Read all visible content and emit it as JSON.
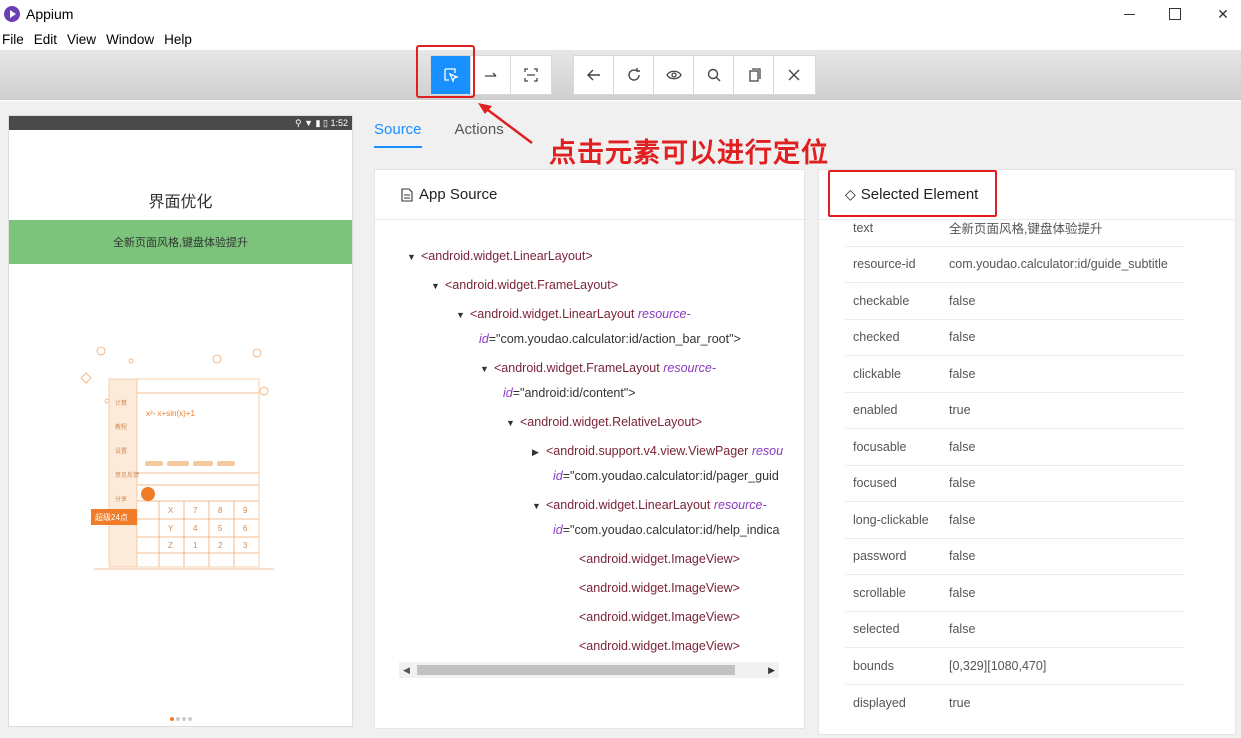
{
  "window": {
    "title": "Appium"
  },
  "menu": [
    "File",
    "Edit",
    "View",
    "Window",
    "Help"
  ],
  "toolbar": {
    "group1": [
      {
        "name": "select-elements-icon",
        "active": true
      },
      {
        "name": "swipe-icon",
        "active": false
      },
      {
        "name": "tap-coordinates-icon",
        "active": false
      }
    ],
    "group2": [
      {
        "name": "back-icon"
      },
      {
        "name": "refresh-icon"
      },
      {
        "name": "eye-icon"
      },
      {
        "name": "search-icon"
      },
      {
        "name": "copy-icon"
      },
      {
        "name": "close-icon"
      }
    ]
  },
  "device": {
    "status_time": "1:52",
    "title": "界面优化",
    "banner": "全新页面风格,键盘体验提升",
    "illus": {
      "side_items": [
        "计算",
        "教程",
        "设置",
        "意见反馈",
        "分享"
      ],
      "formula": "x²- x+sin(x)+1",
      "badge": "超级24点",
      "keys": [
        "X",
        "7",
        "8",
        "9",
        "Y",
        "4",
        "5",
        "6",
        "Z",
        "1",
        "2",
        "3"
      ]
    }
  },
  "tabs": {
    "source": "Source",
    "actions": "Actions"
  },
  "annotation": "点击元素可以进行定位",
  "source_panel": {
    "title": "App Source",
    "nodes": [
      {
        "tag": "<android.widget.LinearLayout>",
        "attr": "",
        "attr_val": ""
      },
      {
        "tag": "<android.widget.FrameLayout>",
        "attr": "",
        "attr_val": ""
      },
      {
        "tag": "<android.widget.LinearLayout",
        "attr": "resource-",
        "line2_attr": "id",
        "attr_val": "=\"com.youdao.calculator:id/action_bar_root\">"
      },
      {
        "tag": "<android.widget.FrameLayout",
        "attr": "resource-",
        "line2_attr": "id",
        "attr_val": "=\"android:id/content\">"
      },
      {
        "tag": "<android.widget.RelativeLayout>",
        "attr": "",
        "attr_val": ""
      },
      {
        "tag": "<android.support.v4.view.ViewPager",
        "attr": "resou",
        "line2_attr": "id",
        "attr_val": "=\"com.youdao.calculator:id/pager_guid"
      },
      {
        "tag": "<android.widget.LinearLayout",
        "attr": "resource-",
        "line2_attr": "id",
        "attr_val": "=\"com.youdao.calculator:id/help_indica"
      },
      {
        "tag": "<android.widget.ImageView>",
        "attr": "",
        "attr_val": ""
      },
      {
        "tag": "<android.widget.ImageView>",
        "attr": "",
        "attr_val": ""
      },
      {
        "tag": "<android.widget.ImageView>",
        "attr": "",
        "attr_val": ""
      },
      {
        "tag": "<android.widget.ImageView>",
        "attr": "",
        "attr_val": ""
      }
    ]
  },
  "selected_panel": {
    "title": "Selected Element",
    "props": [
      {
        "k": "text",
        "v": "全新页面风格,键盘体验提升"
      },
      {
        "k": "resource-id",
        "v": "com.youdao.calculator:id/guide_subtitle"
      },
      {
        "k": "checkable",
        "v": "false"
      },
      {
        "k": "checked",
        "v": "false"
      },
      {
        "k": "clickable",
        "v": "false"
      },
      {
        "k": "enabled",
        "v": "true"
      },
      {
        "k": "focusable",
        "v": "false"
      },
      {
        "k": "focused",
        "v": "false"
      },
      {
        "k": "long-clickable",
        "v": "false"
      },
      {
        "k": "password",
        "v": "false"
      },
      {
        "k": "scrollable",
        "v": "false"
      },
      {
        "k": "selected",
        "v": "false"
      },
      {
        "k": "bounds",
        "v": "[0,329][1080,470]"
      },
      {
        "k": "displayed",
        "v": "true"
      }
    ]
  },
  "colors": {
    "accent": "#1890ff",
    "annotation": "#e02020",
    "banner": "#7cc47c"
  }
}
